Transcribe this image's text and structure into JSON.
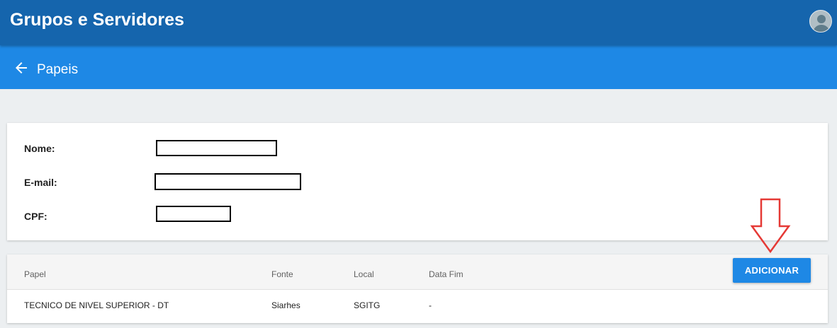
{
  "app_bar": {
    "title": "Grupos e Servidores",
    "avatar_icon": "user-avatar-icon"
  },
  "sub_bar": {
    "back_icon": "arrow-left-icon",
    "title": "Papeis"
  },
  "info": {
    "nome_label": "Nome:",
    "email_label": "E-mail:",
    "cpf_label": "CPF:"
  },
  "table": {
    "headers": {
      "papel": "Papel",
      "fonte": "Fonte",
      "local": "Local",
      "data_fim": "Data Fim"
    },
    "add_button": "ADICIONAR",
    "rows": [
      {
        "papel": "TECNICO DE NIVEL SUPERIOR - DT",
        "fonte": "Siarhes",
        "local": "SGITG",
        "data_fim": "-"
      }
    ]
  },
  "annotation": {
    "icon": "arrow-down-outline-icon",
    "color": "#e53935"
  },
  "colors": {
    "app_bar": "#1565ad",
    "sub_bar": "#1e88e5",
    "button": "#1e88e5",
    "background": "#eceff1"
  }
}
